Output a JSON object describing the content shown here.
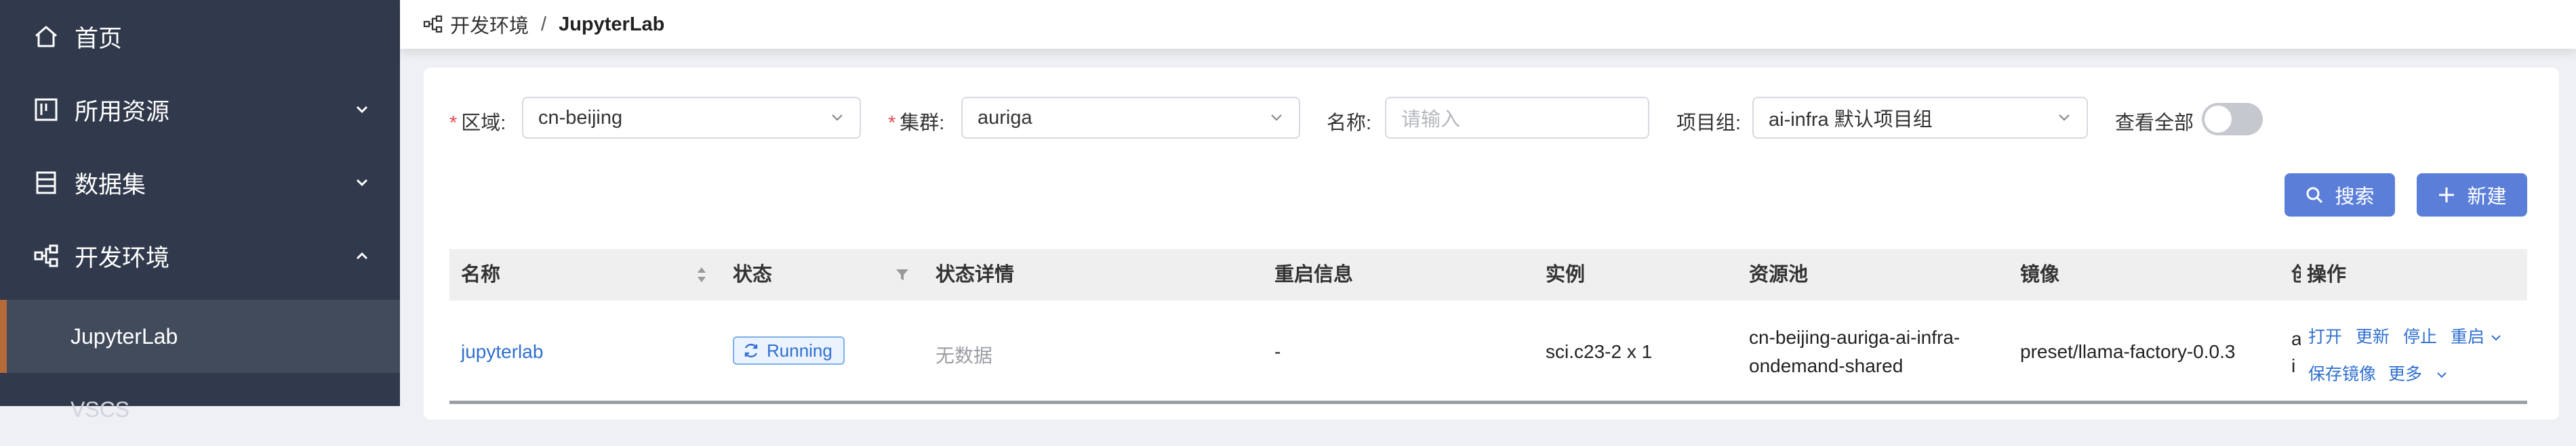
{
  "sidebar": {
    "items": [
      {
        "label": "首页",
        "icon": "home-icon"
      },
      {
        "label": "所用资源",
        "icon": "resource-icon"
      },
      {
        "label": "数据集",
        "icon": "dataset-icon"
      },
      {
        "label": "开发环境",
        "icon": "dev-env-icon"
      }
    ],
    "sub_items": [
      "JupyterLab",
      "VSCS"
    ]
  },
  "breadcrumb": {
    "parent": "开发环境",
    "separator": "/",
    "current": "JupyterLab"
  },
  "filters": {
    "region_label": "区域:",
    "region_value": "cn-beijing",
    "cluster_label": "集群:",
    "cluster_value": "auriga",
    "name_label": "名称:",
    "name_placeholder": "请输入",
    "project_label": "项目组:",
    "project_value": "ai-infra 默认项目组",
    "view_all_label": "查看全部",
    "required_mark": "*"
  },
  "actions": {
    "search_label": "搜索",
    "create_label": "新建"
  },
  "table": {
    "columns": [
      "名称",
      "状态",
      "状态详情",
      "重启信息",
      "实例",
      "资源池",
      "镜像",
      "创建",
      "操作"
    ],
    "rows": [
      {
        "name": "jupyterlab",
        "status": "Running",
        "status_detail": "无数据",
        "restart_info": "-",
        "instance": "sci.c23-2 x 1",
        "pool_line1": "cn-beijing-auriga-ai-infra-",
        "pool_line2": "ondemand-shared",
        "image": "preset/llama-factory-0.0.3",
        "created_clip1": "a",
        "created_clip2": "i",
        "ops": {
          "open": "打开",
          "update": "更新",
          "stop": "停止",
          "restart": "重启",
          "save_image": "保存镜像",
          "more": "更多"
        }
      }
    ]
  },
  "colors": {
    "sidebar_bg": "#313a4c",
    "accent": "#5b7fd9",
    "link": "#2f6fd0",
    "active_marker": "#b46a39",
    "required": "#e5484d"
  }
}
